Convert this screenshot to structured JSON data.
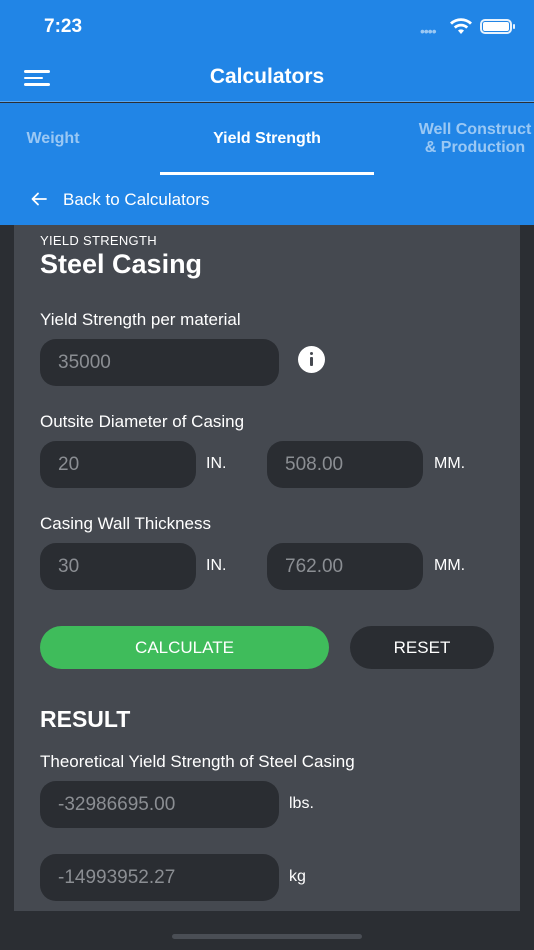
{
  "status_bar": {
    "time": "7:23",
    "dots": "••••"
  },
  "header": {
    "title": "Calculators"
  },
  "tabs": [
    {
      "label": "Weight"
    },
    {
      "label": "Yield Strength"
    },
    {
      "label_line1": "Well Construct",
      "label_line2": "& Production"
    }
  ],
  "back": {
    "label": "Back to Calculators"
  },
  "calculator": {
    "eyebrow": "YIELD STRENGTH",
    "title": "Steel Casing",
    "yield_strength": {
      "label": "Yield Strength per material",
      "value": "35000"
    },
    "outside_diameter": {
      "label": "Outsite Diameter of Casing",
      "in_value": "20",
      "in_unit": "IN.",
      "mm_value": "508.00",
      "mm_unit": "MM."
    },
    "wall_thickness": {
      "label": "Casing Wall Thickness",
      "in_value": "30",
      "in_unit": "IN.",
      "mm_value": "762.00",
      "mm_unit": "MM."
    },
    "buttons": {
      "calculate": "CALCULATE",
      "reset": "RESET"
    }
  },
  "result": {
    "heading": "RESULT",
    "label": "Theoretical Yield Strength of Steel Casing",
    "lbs_value": "-32986695.00",
    "lbs_unit": "lbs.",
    "kg_value": "-14993952.27",
    "kg_unit": "kg"
  },
  "colors": {
    "primary": "#2185e6",
    "card": "#454950",
    "field": "#2a2d32",
    "calculate": "#3fbc5b"
  },
  "icons": [
    "menu-icon",
    "wifi-icon",
    "battery-icon",
    "back-arrow-icon",
    "info-icon"
  ]
}
